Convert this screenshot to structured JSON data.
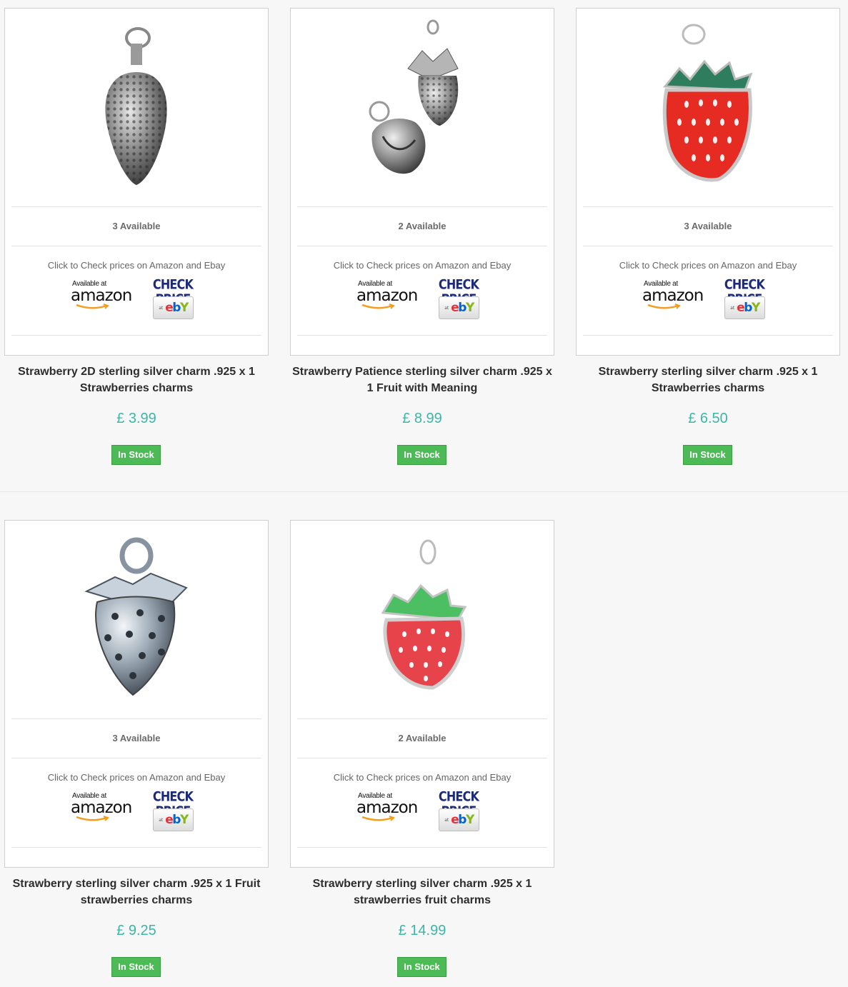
{
  "products": [
    {
      "image": "strawberry-2d-silver-charm",
      "available": "3 Available",
      "check_text": "Click to Check prices on Amazon and Ebay",
      "amazon_small": "Available at",
      "amazon_word": "amazon",
      "check_price": "CHECK PRICE",
      "ebay": "ebY",
      "title": "Strawberry 2D sterling silver charm .925 x 1 Strawberries charms",
      "price": "£ 3.99",
      "stock": "In Stock"
    },
    {
      "image": "strawberry-patience-silver-charm",
      "available": "2 Available",
      "check_text": "Click to Check prices on Amazon and Ebay",
      "amazon_small": "Available at",
      "amazon_word": "amazon",
      "check_price": "CHECK PRICE",
      "ebay": "ebY",
      "title": "Strawberry Patience sterling silver charm .925 x 1 Fruit with Meaning",
      "price": "£ 8.99",
      "stock": "In Stock"
    },
    {
      "image": "strawberry-enamel-red-charm",
      "available": "3 Available",
      "check_text": "Click to Check prices on Amazon and Ebay",
      "amazon_small": "Available at",
      "amazon_word": "amazon",
      "check_price": "CHECK PRICE",
      "ebay": "ebY",
      "title": "Strawberry sterling silver charm .925 x 1 Strawberries charms",
      "price": "£ 6.50",
      "stock": "In Stock"
    },
    {
      "image": "strawberry-3d-silver-charm",
      "available": "3 Available",
      "check_text": "Click to Check prices on Amazon and Ebay",
      "amazon_small": "Available at",
      "amazon_word": "amazon",
      "check_price": "CHECK PRICE",
      "ebay": "ebY",
      "title": "Strawberry sterling silver charm .925 x 1 Fruit strawberries charms",
      "price": "£ 9.25",
      "stock": "In Stock"
    },
    {
      "image": "strawberry-enamel-pink-charm",
      "available": "2 Available",
      "check_text": "Click to Check prices on Amazon and Ebay",
      "amazon_small": "Available at",
      "amazon_word": "amazon",
      "check_price": "CHECK PRICE",
      "ebay": "ebY",
      "title": "Strawberry sterling silver charm .925 x 1 strawberries fruit charms",
      "price": "£ 14.99",
      "stock": "In Stock"
    }
  ],
  "colors": {
    "price": "#3bb6a8",
    "stock_badge": "#4cbb56",
    "check_price": "#1b2a7a"
  }
}
